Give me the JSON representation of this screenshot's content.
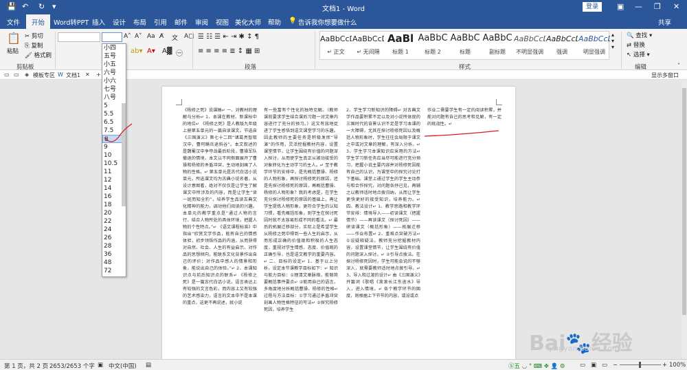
{
  "window": {
    "title": "文档1 - Word",
    "login": "登录"
  },
  "menu": {
    "file": "文件",
    "home": "开始",
    "pdf": "Word转PPT",
    "insert": "插入",
    "design": "设计",
    "layout": "布局",
    "references": "引用",
    "mailings": "邮件",
    "review": "审阅",
    "view": "视图",
    "beauty": "美化大师",
    "help": "帮助",
    "tellme": "告诉我你想要做什么",
    "share": "共享"
  },
  "ribbon": {
    "paste": "粘贴",
    "cut": "剪切",
    "copy": "复制",
    "format_painter": "格式刷",
    "clipboard": "剪贴板",
    "paragraph": "段落",
    "styles_label": "样式",
    "editing": "编辑",
    "find": "查找",
    "replace": "替换",
    "select": "选择"
  },
  "styles": [
    {
      "preview": "AaBbCcDd",
      "name": "↵ 正文"
    },
    {
      "preview": "AaBbCcDd",
      "name": "↵ 无间隔"
    },
    {
      "preview": "AaBl",
      "name": "标题 1"
    },
    {
      "preview": "AaBbC",
      "name": "标题 2"
    },
    {
      "preview": "AaBbC",
      "name": "标题"
    },
    {
      "preview": "AaBbC",
      "name": "副标题"
    },
    {
      "preview": "AaBbCcD",
      "name": "不明显强调"
    },
    {
      "preview": "AaBbCcD",
      "name": "强调"
    },
    {
      "preview": "AaBbCcD",
      "name": "明显强调"
    }
  ],
  "tabbar": {
    "tab1": "模板专区",
    "tab2": "文档1",
    "plus": "+",
    "right": "显示多窗口"
  },
  "font_sizes": [
    "小四",
    "五号",
    "小五",
    "六号",
    "小六",
    "七号",
    "八号",
    "5",
    "5.5",
    "6.5",
    "7.5",
    "8",
    "9",
    "10",
    "10.5",
    "11",
    "12",
    "14",
    "16",
    "18",
    "20",
    "22",
    "24",
    "26",
    "28",
    "36",
    "48",
    "72"
  ],
  "selected_size": "8",
  "document": {
    "col1": "《杨修之死》说课稿↵ 一、对教材的理解与分析↵ 1、本课在教材、新课标中的地位↵ 《杨修之死》是人教版九年级上册第五单元的一篇自读课文。节选自《三国演义》第七十二回“诸葛亮智取汉中，曹阿瞒兵退斜谷”。本文叙述的是魏蜀汉中争夺战最后阶段，曹操军队撤退的情境，本文以不同侧面展开了曹操和杨修的矛盾冲突，生动地刻画了人物的性格。↵ 第五单元是古代白话小说单元，所选课文均为古典小说名著，从设计意图看，绝对不仅仅是让学生了解课文中所涉及的内容，而是让学生“读一斑而知全豹”，培养学生品读古典文化精神的能力，调动他们阅读的兴趣。本单元的教学重点是“通过人物的言行、结合人物所处的具体环境，把握人物的个性特点。”↵ 《语文课程标准》中指出“欣赏文学作品，能有自己的情感体验，初步领悟作品的内涵，从而获得对自然、社会、人生的有益启示。对作品的思想倾向，能联系文化背景作出自己的评价；对作品中感人的情景和形象，能说出自己的体验。”↵ 2、本课知识点与前后知识点的联系↵ 《杨修之死》是一篇古代白话小说，语言表达上有较强的文言色彩，而内容上又有较强的艺术感染力，语言的文本中不是本课的重点，这更不再说述，就小说",
    "col2": "有一些富有个性化的独特见解。（教师课前要求学生结合课后习题一对文章内容进行了充分的预习。）这又有效地促进了学生感悟到语文课堂学习的乐趣。因此教师的主要任务是积极发挥“导演”的作用，灵活挖掘教材内容，设置课堂情节，让学生围绕有价值的问题深入探讨，从而使学生真正从被动接受的对象转化为主动学习的主人。↵ 至于教学环节的安排中，是先概括曹操、杨修的人物形象，再探讨杨修死的原因，还是先探讨杨修死的原因，再概括曹操、杨修的人物形象？我的考虑是，在学生充分探讨杨修死的原因的基础上，再让学生提炼人物形象，更符合学生的认知习惯，看先概括形象，则学生在探讨死因时就不太容易形成不同的看法。↵ 最后的拓展迁移部分，实际上是希望学生从杨修之死中得到一些人生的启示，从而形成正确的价值观和积极的人生态度，重视对学生情感、态度、价值观的正确引导，也是语文教学的重要内容。↵ 二、目标的设定↵ 1、基于以上分析，设定本节课教学目标如下：↵ 知识与能力目标：①理清文章脉络，能够简要概括事件要点↵ ②能用自己的语言，多角度地分析概括曹操、杨修的性格↵ 过程与方法目标：①学习通过矛盾冲突刻画人物性格特征的写法↵ ②探究杨修死因，培养学生",
    "col3": "2、学生学习新知识的障碍↵ 对古典文学作品要积累不足以及对小说所体现的三国时代的背景认识不足是学习本课的一大障碍，尤其在探讨杨修死因以及概括人物形象时，学生往往会局限于课文之中或对文章的理解，有深入分析。↵ 3、学生学习本课知识应采用的方法↵ 学生学习新任务应当尽可能进行充分预习，把握小说主要内容并对杨修死因能有自己的认识，为课堂中的探究讨论打下基础。课堂上通过学生的学生主动参与和合作探究，对问题各抒己见，再辅之以教师适时地点拨归纳，从而让学生更快更好的接受知识，培养能力。↵ 四、教法设计↵ 1、教学思路和教学环节安排：情境导入——初读课文（把握情节）——再读课文（探讨死因）——研读课文（概括形象）——拓展迁移——作业布置↵ 2、重难点突破方法↵ ①设疑释疑法。教师充分挖掘教材内容，设置课堂情节，让学生围绕有价值的问题深入探讨。↵ ②引导点拨法。在探讨杨修死因时，学生可能会说的不够深入，就需要教师适时地点拨引导。↵ 3、导入和过渡的设计↵ 由《三国演义》开篇词《歌唱《滚滚长江东逝水》导入，进入情境。↵ 各个教学环节的国度，则根据上下节节的内容，或设或点",
    "col4": "作业二需要学生有一定的阅读积累，并能对问题有自己的思考和见解，有一定的挑战性。↵"
  },
  "status": {
    "page": "第 1 页，共 2 页",
    "words": "2653/2653 个字",
    "lang": "中文(中国)",
    "zoom": "100%"
  },
  "watermark": {
    "main": "Bai",
    "sub": "jingyan.baidu.com",
    "mid": "经验"
  },
  "colors": {
    "brand": "#2b579a",
    "annotation": "#d42020"
  }
}
